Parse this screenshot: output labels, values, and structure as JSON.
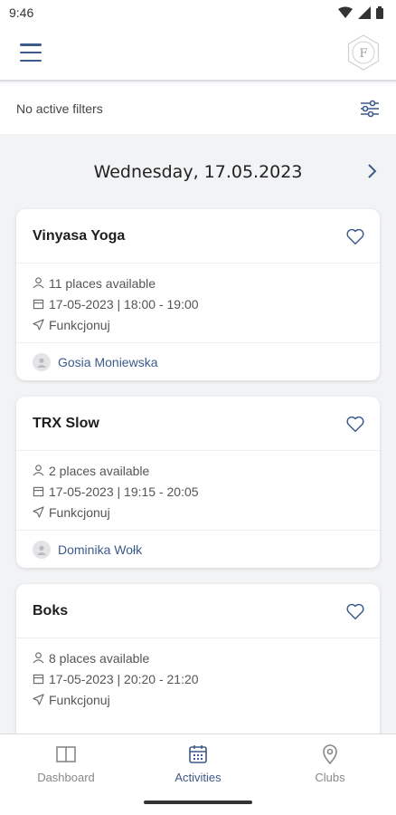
{
  "status_bar": {
    "time": "9:46"
  },
  "app_bar": {
    "menu_icon": "hamburger-icon",
    "logo_letter": "F"
  },
  "filters": {
    "label": "No active filters",
    "icon": "sliders-icon"
  },
  "date_nav": {
    "date": "Wednesday, 17.05.2023",
    "next_icon": "chevron-right-icon"
  },
  "classes": [
    {
      "title": "Vinyasa Yoga",
      "places": "11 places available",
      "datetime": "17-05-2023 | 18:00 - 19:00",
      "location": "Funkcjonuj",
      "instructor": "Gosia Moniewska"
    },
    {
      "title": "TRX Slow",
      "places": "2 places available",
      "datetime": "17-05-2023 | 19:15 - 20:05",
      "location": "Funkcjonuj",
      "instructor": "Dominika Wołk"
    },
    {
      "title": "Boks",
      "places": "8 places available",
      "datetime": "17-05-2023 | 20:20 - 21:20",
      "location": "Funkcjonuj",
      "instructor": ""
    }
  ],
  "bottom_nav": [
    {
      "label": "Dashboard",
      "icon": "book-icon",
      "active": false
    },
    {
      "label": "Activities",
      "icon": "calendar-icon",
      "active": true
    },
    {
      "label": "Clubs",
      "icon": "map-pin-icon",
      "active": false
    }
  ],
  "colors": {
    "accent": "#3c5a8a",
    "background": "#f2f3f5",
    "card": "#ffffff"
  }
}
